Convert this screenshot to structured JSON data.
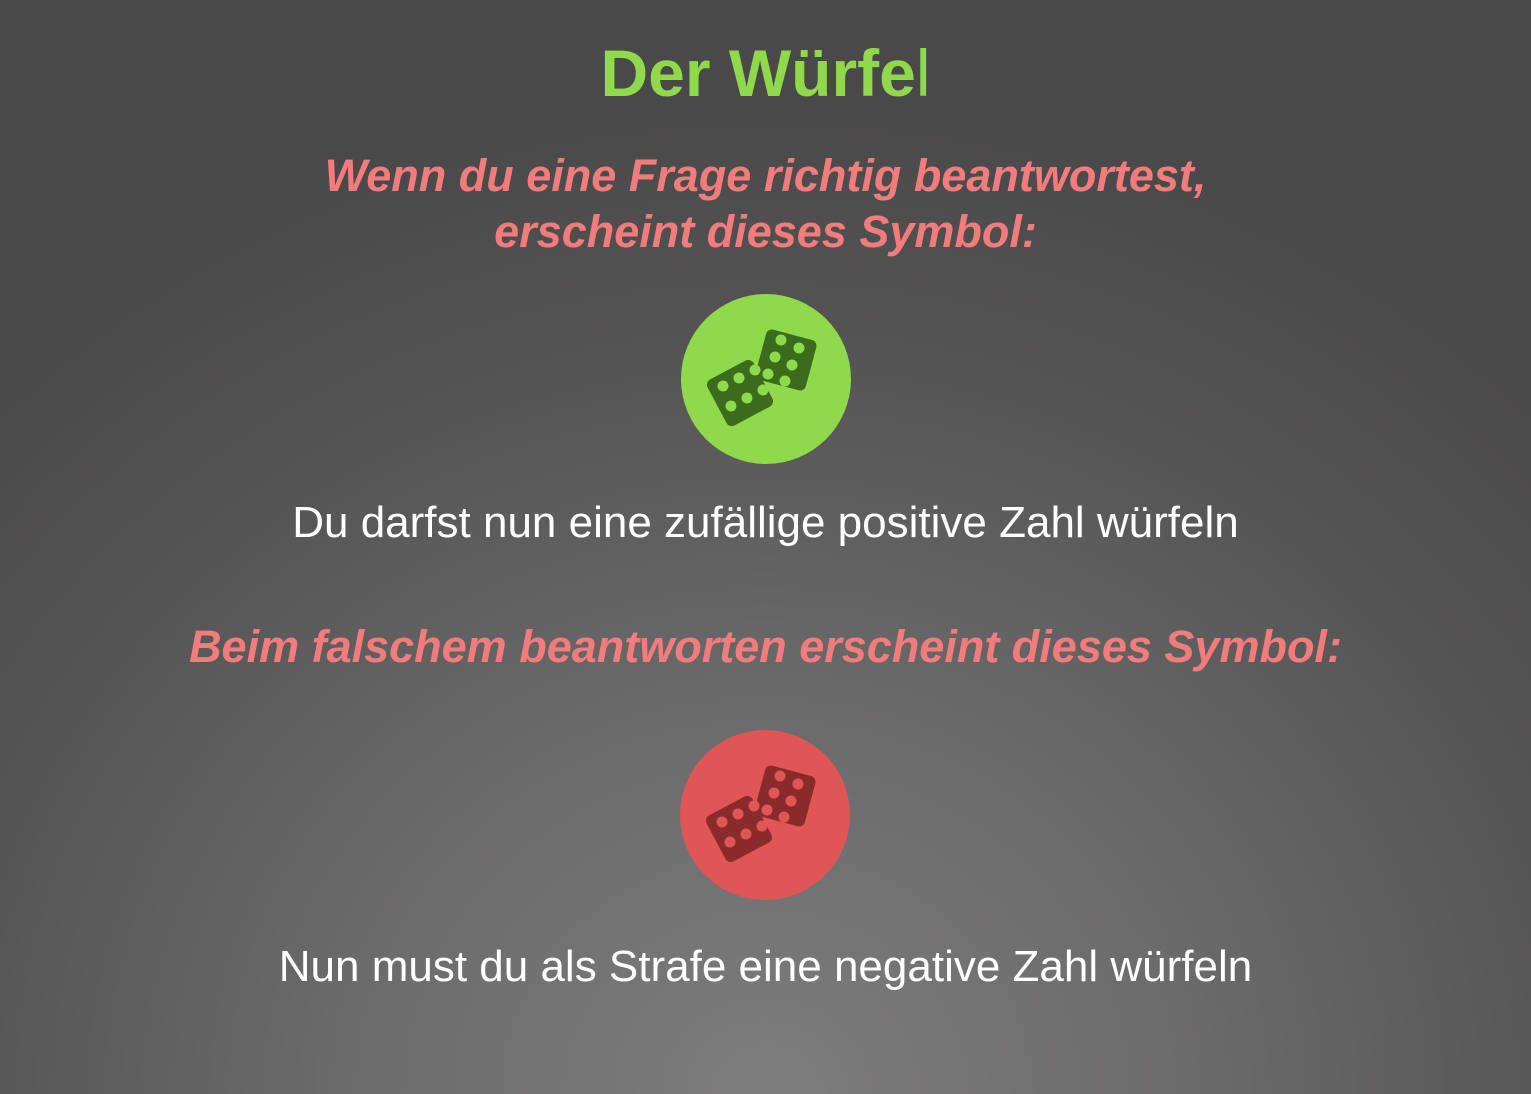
{
  "title": {
    "main": "Der Würfe",
    "tail": "l"
  },
  "correct": {
    "prompt_line1": "Wenn du eine Frage richtig beantwortest,",
    "prompt_line2": "erscheint dieses Symbol:",
    "icon": "dice-icon",
    "info": "Du darfst nun eine zufällige positive Zahl würfeln"
  },
  "wrong": {
    "prompt": "Beim falschem beantworten erscheint dieses Symbol:",
    "icon": "dice-icon",
    "info": "Nun must du als Strafe eine negative Zahl würfeln"
  },
  "colors": {
    "title": "#8fd94a",
    "prompt": "#f27c7c",
    "info": "#ffffff",
    "badge_green": "#8fd94a",
    "dice_green": "#3b6b1c",
    "pip_green": "#8fd94a",
    "badge_red": "#e05555",
    "dice_red": "#8a2b2b",
    "pip_red": "#e05555"
  }
}
